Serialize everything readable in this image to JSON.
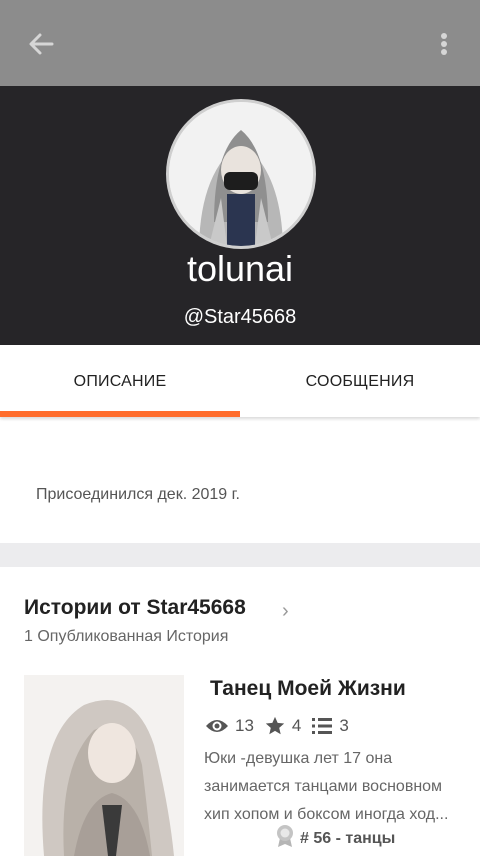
{
  "profile": {
    "username": "tolunai",
    "handle": "@Star45668"
  },
  "tabs": [
    {
      "label": "ОПИСАНИЕ",
      "active": true
    },
    {
      "label": "СООБЩЕНИЯ",
      "active": false
    }
  ],
  "about": {
    "joined": "Присоединился дек. 2019 г."
  },
  "stories": {
    "title": "Истории от Star45668",
    "count": "1 Опубликованная История",
    "items": [
      {
        "title": "Танец Моей Жизни",
        "reads": "13",
        "votes": "4",
        "parts": "3",
        "description_lines": [
          "Юки -девушка лет 17 она",
          "занимается танцами восновном",
          "хип хопом и боксом иногда ход..."
        ],
        "rank": "# 56 - танцы"
      }
    ]
  },
  "colors": {
    "accent": "#ff6d2d",
    "header_bg": "#262528",
    "topbar_bg": "#8c8c8c"
  },
  "icons": [
    "back-arrow-icon",
    "more-vertical-icon",
    "eye-icon",
    "star-icon",
    "list-icon",
    "award-icon",
    "chevron-right-icon"
  ]
}
